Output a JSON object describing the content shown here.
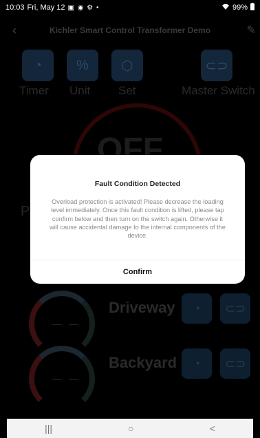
{
  "status_bar": {
    "time": "10:03",
    "date": "Fri, May 12",
    "notif_icons": "▣ ◉ ⚙ •",
    "battery": "99%"
  },
  "app": {
    "title": "Kichler Smart Control Transformer Demo",
    "tiles": [
      {
        "icon": "timer-icon",
        "label": "Timer"
      },
      {
        "icon": "percent-icon",
        "label": "Unit"
      },
      {
        "icon": "settings-icon",
        "label": "Set"
      },
      {
        "icon": "master-switch-icon",
        "label": "Master Switch"
      }
    ],
    "power_state": "OFF",
    "section_initial": "P",
    "zones": [
      {
        "name": "Driveway",
        "reading": "— —"
      },
      {
        "name": "Backyard",
        "reading": "— —"
      }
    ]
  },
  "dialog": {
    "title": "Fault Condition Detected",
    "message": "Overload protection is activated! Please decrease the loading level immediately. Once this fault condition is lifted, please tap confirm below and then turn on the switch again. Otherwise it will cause accidental damage to the internal components of the device.",
    "confirm_label": "Confirm"
  },
  "sys_nav": {
    "recents": "|||",
    "home": "○",
    "back": "<"
  },
  "colors": {
    "background": "#000000",
    "dialog_bg": "#ffffff",
    "tile": "#13263a"
  }
}
